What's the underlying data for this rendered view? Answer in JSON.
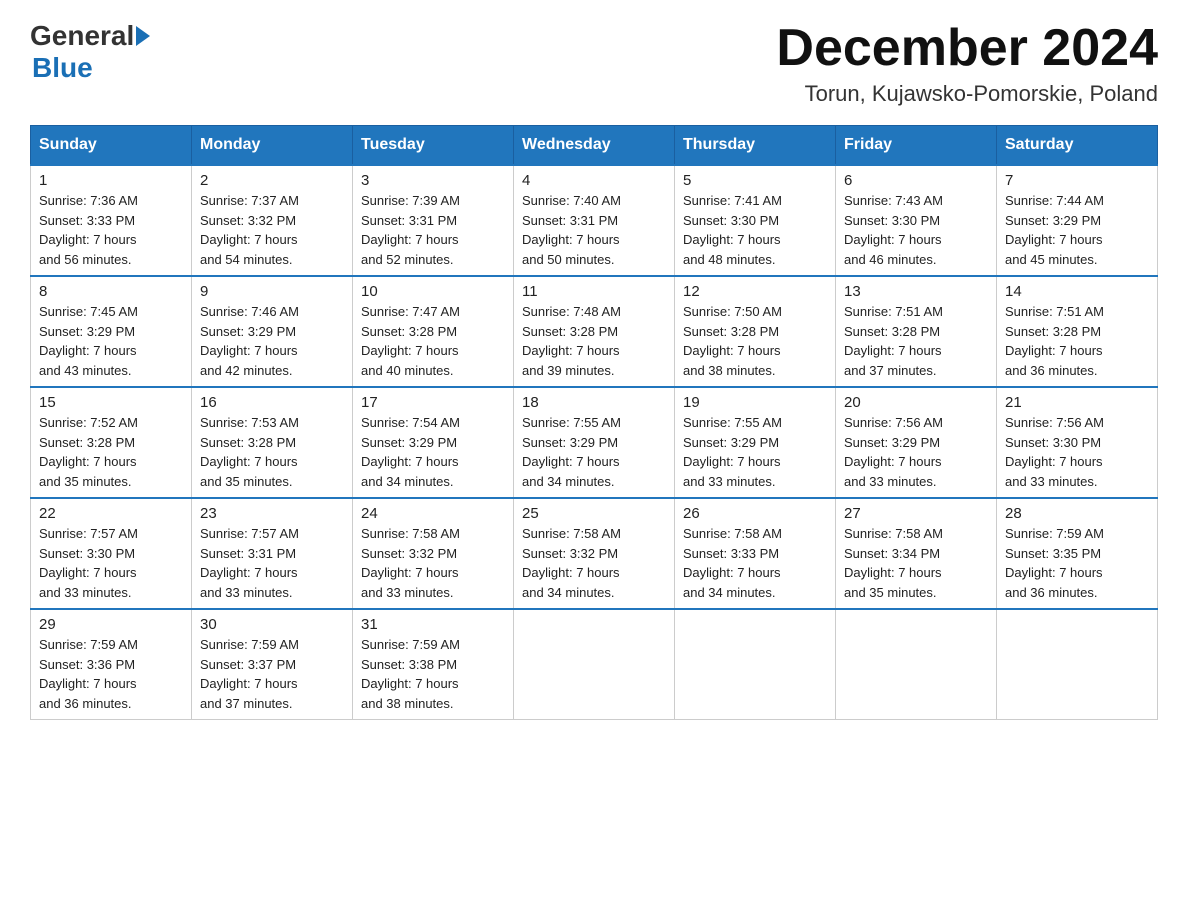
{
  "header": {
    "logo_general": "General",
    "logo_blue": "Blue",
    "title": "December 2024",
    "location": "Torun, Kujawsko-Pomorskie, Poland"
  },
  "days_of_week": [
    "Sunday",
    "Monday",
    "Tuesday",
    "Wednesday",
    "Thursday",
    "Friday",
    "Saturday"
  ],
  "weeks": [
    [
      {
        "day": "1",
        "sunrise": "7:36 AM",
        "sunset": "3:33 PM",
        "daylight": "7 hours and 56 minutes."
      },
      {
        "day": "2",
        "sunrise": "7:37 AM",
        "sunset": "3:32 PM",
        "daylight": "7 hours and 54 minutes."
      },
      {
        "day": "3",
        "sunrise": "7:39 AM",
        "sunset": "3:31 PM",
        "daylight": "7 hours and 52 minutes."
      },
      {
        "day": "4",
        "sunrise": "7:40 AM",
        "sunset": "3:31 PM",
        "daylight": "7 hours and 50 minutes."
      },
      {
        "day": "5",
        "sunrise": "7:41 AM",
        "sunset": "3:30 PM",
        "daylight": "7 hours and 48 minutes."
      },
      {
        "day": "6",
        "sunrise": "7:43 AM",
        "sunset": "3:30 PM",
        "daylight": "7 hours and 46 minutes."
      },
      {
        "day": "7",
        "sunrise": "7:44 AM",
        "sunset": "3:29 PM",
        "daylight": "7 hours and 45 minutes."
      }
    ],
    [
      {
        "day": "8",
        "sunrise": "7:45 AM",
        "sunset": "3:29 PM",
        "daylight": "7 hours and 43 minutes."
      },
      {
        "day": "9",
        "sunrise": "7:46 AM",
        "sunset": "3:29 PM",
        "daylight": "7 hours and 42 minutes."
      },
      {
        "day": "10",
        "sunrise": "7:47 AM",
        "sunset": "3:28 PM",
        "daylight": "7 hours and 40 minutes."
      },
      {
        "day": "11",
        "sunrise": "7:48 AM",
        "sunset": "3:28 PM",
        "daylight": "7 hours and 39 minutes."
      },
      {
        "day": "12",
        "sunrise": "7:50 AM",
        "sunset": "3:28 PM",
        "daylight": "7 hours and 38 minutes."
      },
      {
        "day": "13",
        "sunrise": "7:51 AM",
        "sunset": "3:28 PM",
        "daylight": "7 hours and 37 minutes."
      },
      {
        "day": "14",
        "sunrise": "7:51 AM",
        "sunset": "3:28 PM",
        "daylight": "7 hours and 36 minutes."
      }
    ],
    [
      {
        "day": "15",
        "sunrise": "7:52 AM",
        "sunset": "3:28 PM",
        "daylight": "7 hours and 35 minutes."
      },
      {
        "day": "16",
        "sunrise": "7:53 AM",
        "sunset": "3:28 PM",
        "daylight": "7 hours and 35 minutes."
      },
      {
        "day": "17",
        "sunrise": "7:54 AM",
        "sunset": "3:29 PM",
        "daylight": "7 hours and 34 minutes."
      },
      {
        "day": "18",
        "sunrise": "7:55 AM",
        "sunset": "3:29 PM",
        "daylight": "7 hours and 34 minutes."
      },
      {
        "day": "19",
        "sunrise": "7:55 AM",
        "sunset": "3:29 PM",
        "daylight": "7 hours and 33 minutes."
      },
      {
        "day": "20",
        "sunrise": "7:56 AM",
        "sunset": "3:29 PM",
        "daylight": "7 hours and 33 minutes."
      },
      {
        "day": "21",
        "sunrise": "7:56 AM",
        "sunset": "3:30 PM",
        "daylight": "7 hours and 33 minutes."
      }
    ],
    [
      {
        "day": "22",
        "sunrise": "7:57 AM",
        "sunset": "3:30 PM",
        "daylight": "7 hours and 33 minutes."
      },
      {
        "day": "23",
        "sunrise": "7:57 AM",
        "sunset": "3:31 PM",
        "daylight": "7 hours and 33 minutes."
      },
      {
        "day": "24",
        "sunrise": "7:58 AM",
        "sunset": "3:32 PM",
        "daylight": "7 hours and 33 minutes."
      },
      {
        "day": "25",
        "sunrise": "7:58 AM",
        "sunset": "3:32 PM",
        "daylight": "7 hours and 34 minutes."
      },
      {
        "day": "26",
        "sunrise": "7:58 AM",
        "sunset": "3:33 PM",
        "daylight": "7 hours and 34 minutes."
      },
      {
        "day": "27",
        "sunrise": "7:58 AM",
        "sunset": "3:34 PM",
        "daylight": "7 hours and 35 minutes."
      },
      {
        "day": "28",
        "sunrise": "7:59 AM",
        "sunset": "3:35 PM",
        "daylight": "7 hours and 36 minutes."
      }
    ],
    [
      {
        "day": "29",
        "sunrise": "7:59 AM",
        "sunset": "3:36 PM",
        "daylight": "7 hours and 36 minutes."
      },
      {
        "day": "30",
        "sunrise": "7:59 AM",
        "sunset": "3:37 PM",
        "daylight": "7 hours and 37 minutes."
      },
      {
        "day": "31",
        "sunrise": "7:59 AM",
        "sunset": "3:38 PM",
        "daylight": "7 hours and 38 minutes."
      },
      null,
      null,
      null,
      null
    ]
  ],
  "labels": {
    "sunrise": "Sunrise: ",
    "sunset": "Sunset: ",
    "daylight": "Daylight: "
  }
}
